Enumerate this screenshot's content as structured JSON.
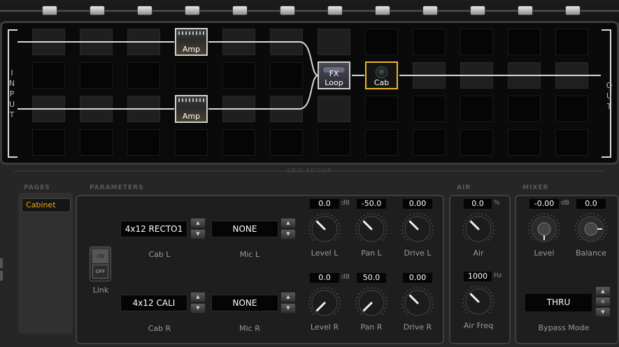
{
  "grid": {
    "input_label": "INPUT",
    "output_label": "OUT",
    "blocks": [
      {
        "label": "Amp",
        "type": "amp"
      },
      {
        "label": "Amp",
        "type": "amp"
      },
      {
        "label": "FX Loop",
        "type": "fx"
      },
      {
        "label": "Cab",
        "type": "cab",
        "selected": true
      }
    ],
    "editor_label": "GRID EDITOR"
  },
  "sections": {
    "pages": "PAGES",
    "parameters": "PARAMETERS",
    "air": "AIR",
    "mixer": "MIXER"
  },
  "pages": {
    "items": [
      "Cabinet"
    ]
  },
  "parameters": {
    "cab_l": {
      "value": "4x12 RECTO1",
      "label": "Cab L"
    },
    "mic_l": {
      "value": "NONE",
      "label": "Mic L"
    },
    "cab_r": {
      "value": "4x12 CALI",
      "label": "Cab R"
    },
    "mic_r": {
      "value": "NONE",
      "label": "Mic R"
    },
    "link": {
      "label": "Link",
      "on": "ON",
      "off": "OFF"
    },
    "level_l": {
      "value": "0.0",
      "unit": "dB",
      "label": "Level L"
    },
    "pan_l": {
      "value": "-50.0",
      "label": "Pan L"
    },
    "drive_l": {
      "value": "0.00",
      "label": "Drive L"
    },
    "level_r": {
      "value": "0.0",
      "unit": "dB",
      "label": "Level R"
    },
    "pan_r": {
      "value": "50.0",
      "label": "Pan R"
    },
    "drive_r": {
      "value": "0.00",
      "label": "Drive R"
    }
  },
  "air": {
    "air": {
      "value": "0.0",
      "unit": "%",
      "label": "Air"
    },
    "air_freq": {
      "value": "1000",
      "unit": "Hz",
      "label": "Air Freq"
    }
  },
  "mixer": {
    "level": {
      "value": "-0.00",
      "unit": "dB",
      "label": "Level"
    },
    "balance": {
      "value": "0.0",
      "label": "Balance"
    },
    "bypass_mode": {
      "value": "THRU",
      "label": "Bypass Mode"
    }
  },
  "colors": {
    "accent": "#f2a81a",
    "selected_block": "#f0b52a",
    "wire": "#d8d8d8"
  }
}
